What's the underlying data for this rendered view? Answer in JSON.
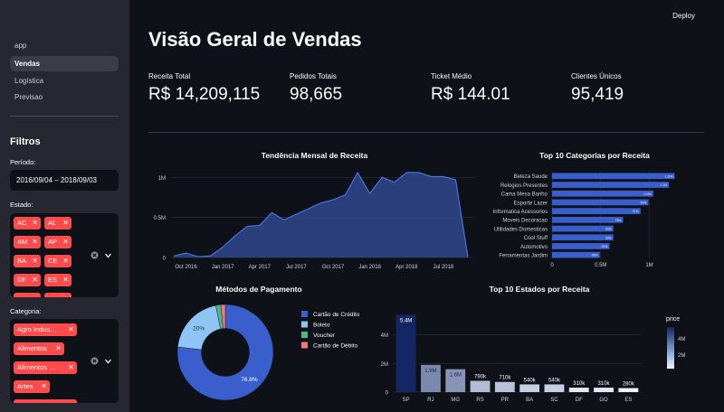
{
  "topbar": {
    "deploy_label": "Deploy"
  },
  "nav": {
    "items": [
      "app",
      "Vendas",
      "Logística",
      "Previsao"
    ],
    "active": "Vendas"
  },
  "filters": {
    "title": "Filtros",
    "period_label": "Período:",
    "period_value": "2016/09/04 – 2018/09/03",
    "state_label": "Estado:",
    "state_chips": [
      "AC",
      "AL",
      "AM",
      "AP",
      "BA",
      "CE",
      "DF",
      "ES"
    ],
    "category_label": "Categoria:",
    "category_chips": [
      "Agro Indus…",
      "Alimentos",
      "Alimentos …",
      "Artes"
    ]
  },
  "page_title": "Visão Geral de Vendas",
  "metrics": [
    {
      "label": "Receita Total",
      "value": "R$ 14,209,115"
    },
    {
      "label": "Pedidos Totais",
      "value": "98,665"
    },
    {
      "label": "Ticket Médio",
      "value": "R$ 144.01"
    },
    {
      "label": "Clientes Únicos",
      "value": "95,419"
    }
  ],
  "colors": {
    "accent": "#ff4b4b",
    "bar_blue": "#3a5fcd",
    "area_fill": "#2d4586",
    "line": "#4c78e8",
    "sidebar_bg": "#262730",
    "main_bg": "#0e1117"
  },
  "chart_data": [
    {
      "type": "area",
      "title": "Tendência Mensal de Receita",
      "x_ticks": [
        "Oct 2016",
        "Jan 2017",
        "Apr 2017",
        "Jul 2017",
        "Oct 2017",
        "Jan 2018",
        "Apr 2018",
        "Jul 2018"
      ],
      "y_ticks": [
        "0",
        "0.5M",
        "1M"
      ],
      "ylim": [
        0,
        1150000
      ],
      "x": [
        "2016-09",
        "2016-10",
        "2016-11",
        "2016-12",
        "2017-01",
        "2017-02",
        "2017-03",
        "2017-04",
        "2017-05",
        "2017-06",
        "2017-07",
        "2017-08",
        "2017-09",
        "2017-10",
        "2017-11",
        "2017-12",
        "2018-01",
        "2018-02",
        "2018-03",
        "2018-04",
        "2018-05",
        "2018-06",
        "2018-07",
        "2018-08",
        "2018-09"
      ],
      "values": [
        20000,
        55000,
        10000,
        20000,
        130000,
        270000,
        390000,
        400000,
        560000,
        470000,
        540000,
        610000,
        680000,
        720000,
        780000,
        1060000,
        800000,
        1000000,
        940000,
        1060000,
        1060000,
        1010000,
        1010000,
        970000,
        5000
      ]
    },
    {
      "type": "bar",
      "orientation": "horizontal",
      "title": "Top 10 Categorias por Receita",
      "categories": [
        "Beleza Saude",
        "Relogios Presentes",
        "Cama Mesa Banho",
        "Esporte Lazer",
        "Informatica Acessorios",
        "Moveis Decoracao",
        "Utilidades Domesticas",
        "Cool Stuff",
        "Automotivo",
        "Ferramentas Jardim"
      ],
      "values": [
        1260000,
        1200000,
        1040000,
        990000,
        910000,
        730000,
        630000,
        630000,
        590000,
        490000
      ],
      "data_labels": [
        "1.26M",
        "1.2M",
        "1.04M",
        "990k",
        "911k",
        "730k",
        "633k",
        "630k",
        "593k",
        "490k"
      ],
      "x_ticks": [
        "0",
        "0.5M",
        "1M"
      ],
      "xlim": [
        0,
        1330000
      ]
    },
    {
      "type": "pie",
      "title": "Métodos de Pagamento",
      "labels": [
        "Cartão de Crédito",
        "Boleto",
        "Voucher",
        "Cartão de Débito"
      ],
      "values": [
        76.8,
        20.0,
        1.7,
        1.5
      ],
      "data_labels": [
        "76.8%",
        "20%",
        "",
        ""
      ],
      "colors": [
        "#3a5fcd",
        "#8ec5f5",
        "#4fb58b",
        "#f07a7a"
      ],
      "hole": 0.5
    },
    {
      "type": "bar",
      "title": "Top 10 Estados por Receita",
      "categories": [
        "SP",
        "RJ",
        "MG",
        "RS",
        "PR",
        "BA",
        "SC",
        "DF",
        "GO",
        "ES"
      ],
      "values": [
        5400000,
        1900000,
        1600000,
        790000,
        710000,
        540000,
        540000,
        310000,
        310000,
        280000
      ],
      "data_labels": [
        "5.4M",
        "1.9M",
        "1.6M",
        "790k",
        "710k",
        "540k",
        "540k",
        "310k",
        "310k",
        "280k"
      ],
      "y_ticks": [
        "0",
        "2M",
        "4M"
      ],
      "ylim": [
        0,
        5800000
      ],
      "colorbar": {
        "title": "price",
        "ticks": [
          "2M",
          "4M"
        ]
      }
    }
  ]
}
